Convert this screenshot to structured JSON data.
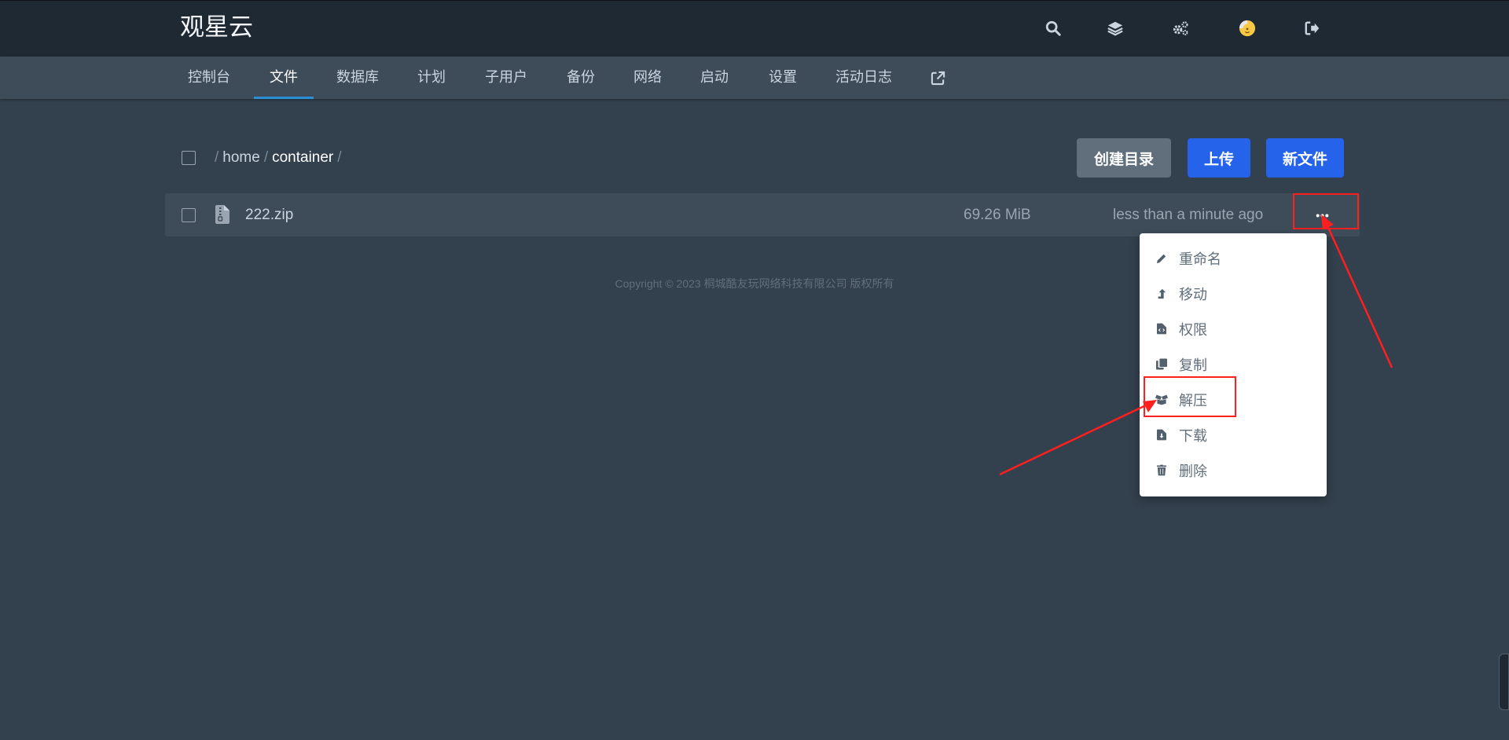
{
  "app": {
    "title": "观星云"
  },
  "nav": {
    "items": [
      {
        "label": "控制台"
      },
      {
        "label": "文件"
      },
      {
        "label": "数据库"
      },
      {
        "label": "计划"
      },
      {
        "label": "子用户"
      },
      {
        "label": "备份"
      },
      {
        "label": "网络"
      },
      {
        "label": "启动"
      },
      {
        "label": "设置"
      },
      {
        "label": "活动日志"
      }
    ],
    "active_index": 1
  },
  "top_icons": [
    "search-icon",
    "layers-icon",
    "cogs-icon",
    "avatar",
    "logout-icon"
  ],
  "breadcrumb": {
    "root": "/",
    "segments": [
      "home",
      "container"
    ]
  },
  "actions": {
    "create_dir": "创建目录",
    "upload": "上传",
    "new_file": "新文件"
  },
  "files": [
    {
      "name": "222.zip",
      "size": "69.26 MiB",
      "modified": "less than a minute ago",
      "icon": "file-archive-icon"
    }
  ],
  "context_menu": {
    "items": [
      {
        "label": "重命名",
        "icon": "pencil-icon"
      },
      {
        "label": "移动",
        "icon": "level-up-icon"
      },
      {
        "label": "权限",
        "icon": "file-code-icon"
      },
      {
        "label": "复制",
        "icon": "copy-icon"
      },
      {
        "label": "解压",
        "icon": "box-open-icon"
      },
      {
        "label": "下载",
        "icon": "file-download-icon"
      },
      {
        "label": "删除",
        "icon": "trash-icon"
      }
    ]
  },
  "footer": {
    "copyright": "Copyright © 2023 桐城酷友玩网络科技有限公司 版权所有"
  },
  "colors": {
    "accent": "#2563eb",
    "annotation": "#ff1f1f",
    "background": "#33404d"
  }
}
